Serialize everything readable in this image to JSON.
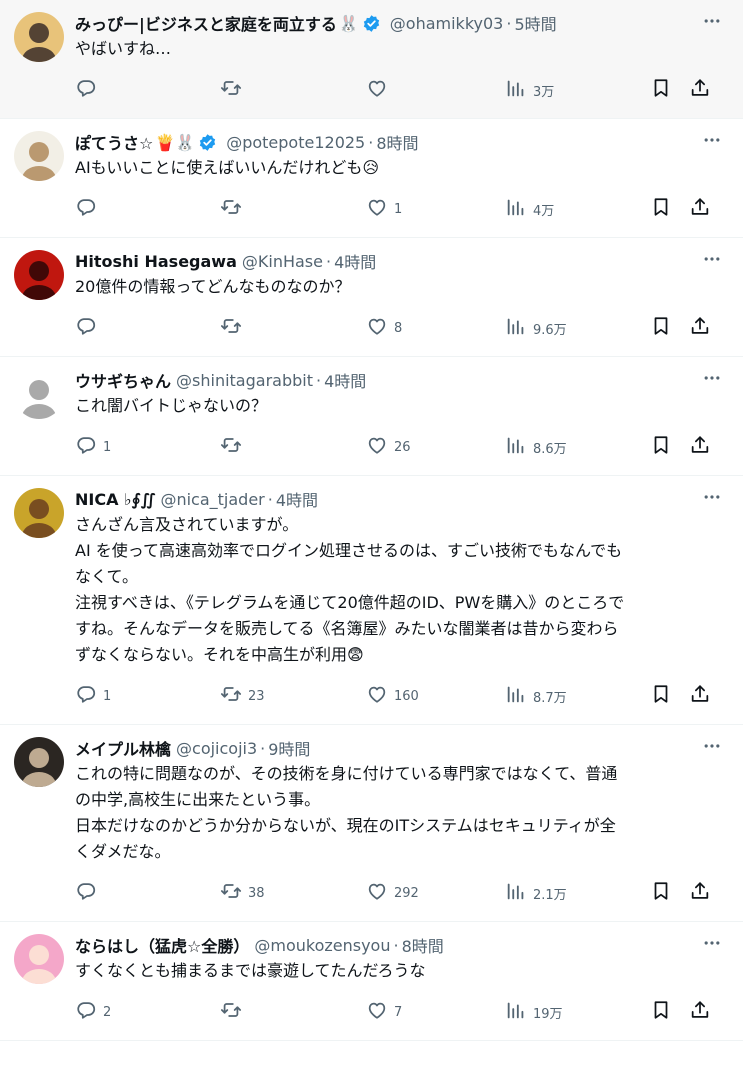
{
  "tweets": [
    {
      "name": "みっぴー|ビジネスと家庭を両立する",
      "emoji": "🐰",
      "verified": true,
      "handle": "@ohamikky03",
      "time": "5時間",
      "lines": [
        "やばいすね…"
      ],
      "reply": "",
      "retweet": "",
      "like": "",
      "views": "3万",
      "avatar_colors": [
        "#e8c37a",
        "#3a2d28"
      ]
    },
    {
      "name": "ぽてうさ☆",
      "emoji": "🍟🐰",
      "verified": true,
      "handle": "@potepote12025",
      "time": "8時間",
      "lines": [
        "AIもいいことに使えばいいんだけれども😥"
      ],
      "reply": "",
      "retweet": "",
      "like": "1",
      "views": "4万",
      "avatar_colors": [
        "#f2efe6",
        "#b08a5a"
      ]
    },
    {
      "name": "Hitoshi Hasegawa",
      "emoji": "",
      "verified": false,
      "handle": "@KinHase",
      "time": "4時間",
      "lines": [
        "20億件の情報ってどんなものなのか？"
      ],
      "reply": "",
      "retweet": "",
      "like": "8",
      "views": "9.6万",
      "avatar_colors": [
        "#c0170f",
        "#2a0606"
      ]
    },
    {
      "name": "ウサギちゃん",
      "emoji": "",
      "verified": false,
      "handle": "@shinitagarabbit",
      "time": "4時間",
      "lines": [
        "これ闇バイトじゃないの？"
      ],
      "reply": "1",
      "retweet": "",
      "like": "26",
      "views": "8.6万",
      "avatar_colors": [
        "#ffffff",
        "#9a9a9a"
      ]
    },
    {
      "name": "NICA ♭∮∬",
      "emoji": "",
      "verified": false,
      "handle": "@nica_tjader",
      "time": "4時間",
      "lines": [
        "さんざん言及されていますが。",
        "AI を使って高速高効率でログイン処理させるのは、すごい技術でもなんでも",
        "なくて。",
        "注視すべきは、《テレグラムを通じて20億件超のID、PWを購入》のところで",
        "すね。そんなデータを販売してる《名簿屋》みたいな闇業者は昔から変わら",
        "ずなくならない。それを中高生が利用😨"
      ],
      "reply": "1",
      "retweet": "23",
      "like": "160",
      "views": "8.7万",
      "avatar_colors": [
        "#c9a42a",
        "#6b3f1f"
      ]
    },
    {
      "name": "メイプル林檎",
      "emoji": "",
      "verified": false,
      "handle": "@cojicoji3",
      "time": "9時間",
      "lines": [
        "これの特に問題なのが、その技術を身に付けている専門家ではなくて、普通",
        "の中学,高校生に出来たという事。",
        "日本だけなのかどうか分からないが、現在のITシステムはセキュリティが全",
        "くダメだな。"
      ],
      "reply": "",
      "retweet": "38",
      "like": "292",
      "views": "2.1万",
      "avatar_colors": [
        "#2b2622",
        "#d8c2a4"
      ]
    },
    {
      "name": "ならはし（猛虎☆全勝）",
      "emoji": "",
      "verified": false,
      "handle": "@moukozensyou",
      "time": "8時間",
      "lines": [
        "すくなくとも捕まるまでは豪遊してたんだろうな"
      ],
      "reply": "2",
      "retweet": "",
      "like": "7",
      "views": "19万",
      "avatar_colors": [
        "#f4a7c9",
        "#fde8d6"
      ]
    }
  ],
  "colors": {
    "text": "#0f1419",
    "muted": "#536471",
    "verified": "#1d9bf0",
    "border": "#eff3f4"
  },
  "icons": [
    "reply-icon",
    "retweet-icon",
    "like-icon",
    "views-icon",
    "bookmark-icon",
    "share-icon",
    "more-icon",
    "verified-icon"
  ]
}
